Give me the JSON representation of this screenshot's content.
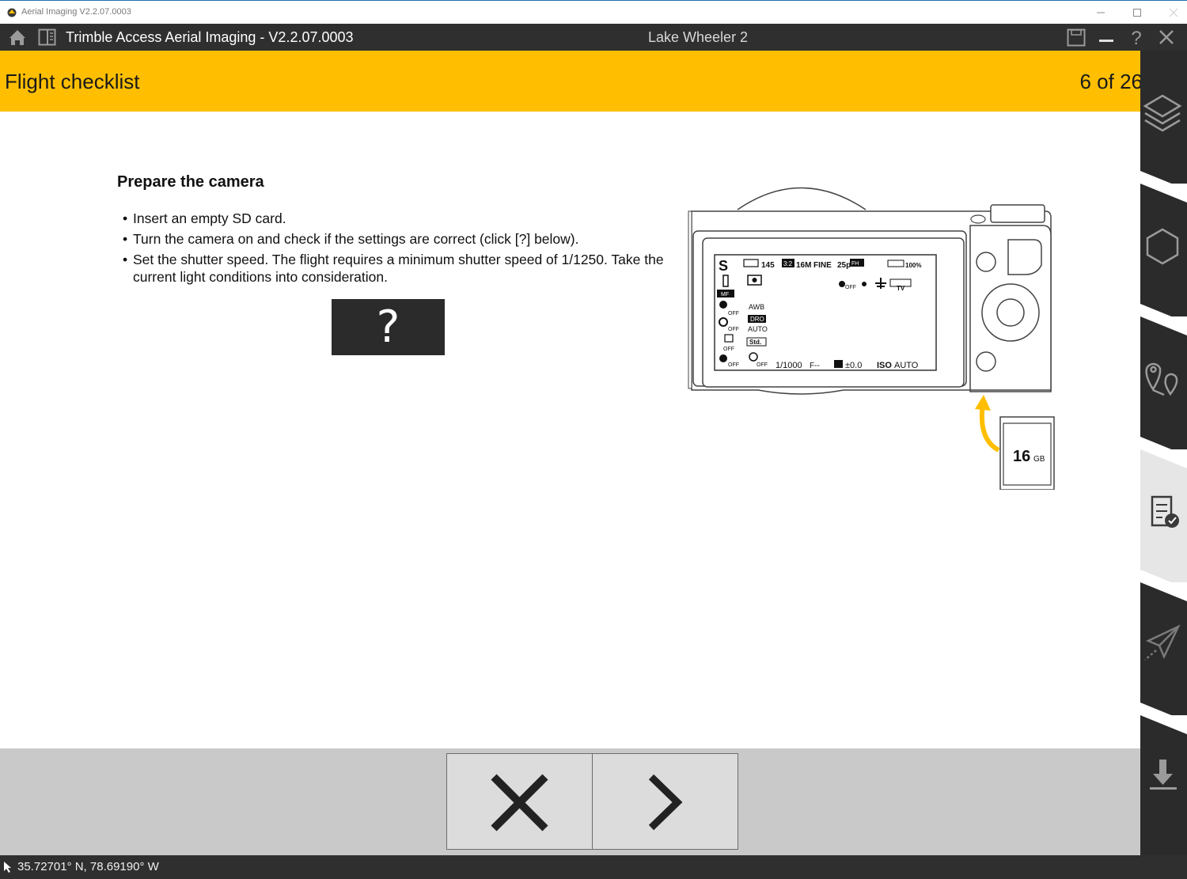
{
  "window": {
    "title": "Aerial Imaging V2.2.07.0003"
  },
  "header": {
    "app_title": "Trimble Access Aerial Imaging - V2.2.07.0003",
    "project_name": "Lake Wheeler 2",
    "icons": [
      "home-icon",
      "panel-toggle-icon",
      "save-icon",
      "minimize-icon",
      "help-icon",
      "close-icon"
    ]
  },
  "banner": {
    "title": "Flight checklist",
    "step_counter": "6 of 26"
  },
  "step": {
    "heading": "Prepare the camera",
    "instructions": [
      "Insert an empty SD card.",
      "Turn the camera on and check if the settings are correct (click [?] below).",
      "Set the shutter speed. The flight requires a minimum shutter speed of 1/1250. Take the current light conditions into consideration."
    ],
    "bullet": "•",
    "help_button_label": "?"
  },
  "camera_display": {
    "mode": "S",
    "shots_remaining": "145",
    "aspect_ratio": "3:2",
    "image_size": "16M",
    "quality": "FINE",
    "movie_format": "25p",
    "movie_badge": "FH",
    "battery": "100%",
    "focus_mode": "MF",
    "white_balance": "AWB",
    "dro_badge": "DRO",
    "dro_value": "AUTO",
    "creative_style": "Std.",
    "off_label": "OFF",
    "shutter_speed": "1/1000",
    "aperture": "F--",
    "exposure_comp": "±0.0",
    "iso_label": "ISO",
    "iso_value": "AUTO",
    "tv_label": "TV",
    "sd_card_size": "16",
    "sd_card_unit": "GB",
    "colors": {
      "arrow": "#ffbf00",
      "screen_border": "#333333"
    }
  },
  "actions": {
    "cancel_icon": "close-x-icon",
    "next_icon": "chevron-right-icon"
  },
  "status_bar": {
    "coordinates": "35.72701° N, 78.69190° W"
  },
  "side_nav": {
    "tabs": [
      "layers-icon",
      "hexagon-area-icon",
      "location-pins-icon",
      "checklist-icon",
      "paper-plane-icon",
      "download-icon"
    ],
    "active_tab": "checklist-icon"
  },
  "colors": {
    "banner": "#ffbf00",
    "header_bg": "#2f2f2f",
    "action_bar_bg": "#c9c9c9",
    "side_nav_bg": "#2b2b2b",
    "side_nav_active": "#e6e6e6"
  }
}
